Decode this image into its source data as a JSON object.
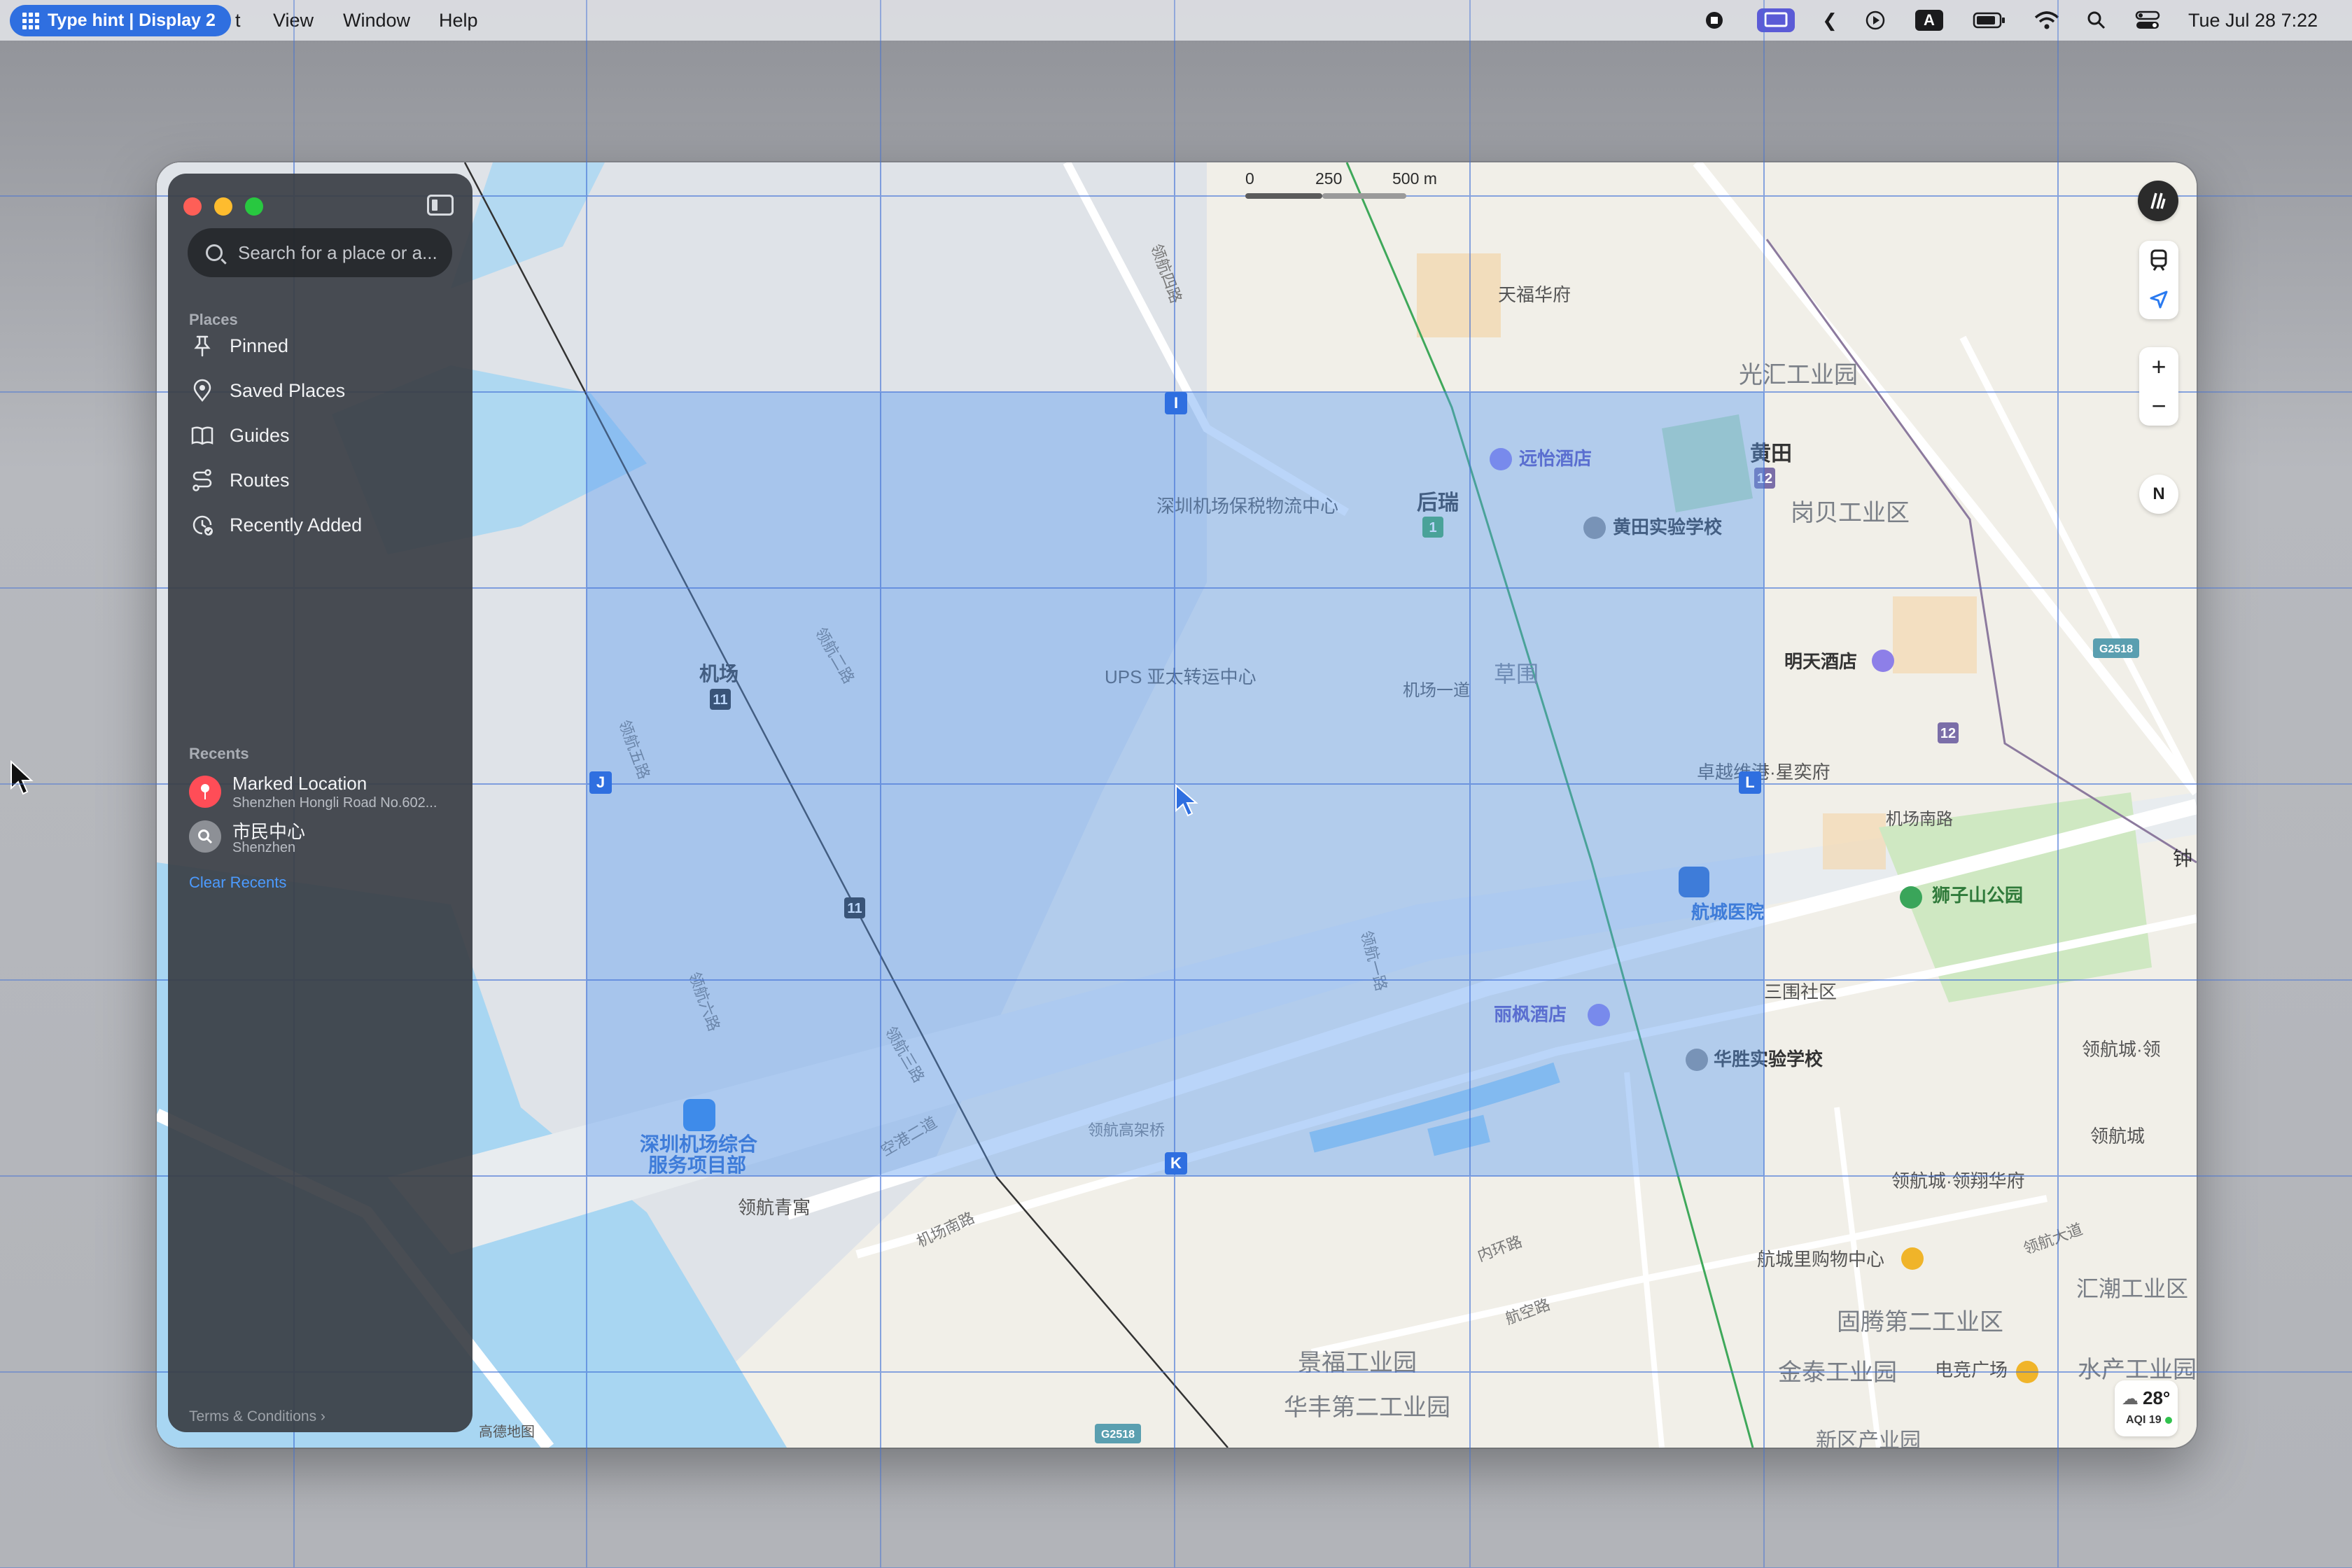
{
  "menubar": {
    "hint_label": "Type hint  |  Display 2",
    "app_menu_tail": "t",
    "items": [
      "View",
      "Window",
      "Help"
    ],
    "clock": "Tue Jul 28  7:22"
  },
  "sidebar": {
    "search_placeholder": "Search for a place or a...",
    "places_header": "Places",
    "places": [
      {
        "label": "Pinned",
        "icon": "pin-icon"
      },
      {
        "label": "Saved Places",
        "icon": "saved-places-icon"
      },
      {
        "label": "Guides",
        "icon": "guides-icon"
      },
      {
        "label": "Routes",
        "icon": "routes-icon"
      },
      {
        "label": "Recently Added",
        "icon": "recently-added-icon"
      }
    ],
    "recents_header": "Recents",
    "recents": [
      {
        "title": "Marked Location",
        "subtitle": "Shenzhen Hongli Road No.602...",
        "icon": "marked-location-icon"
      },
      {
        "title": "市民中心",
        "subtitle": "Shenzhen",
        "icon": "search-icon"
      }
    ],
    "clear_recents": "Clear Recents",
    "terms": "Terms & Conditions"
  },
  "map": {
    "scale": {
      "zero": "0",
      "mid": "250",
      "end": "500 m"
    },
    "compass": "N",
    "zoom_in": "+",
    "zoom_out": "−",
    "attribution": "高德地图",
    "weather": {
      "temp": "28°",
      "aqi": "AQI 19"
    },
    "labels": [
      {
        "text": "天福华府"
      },
      {
        "text": "光汇工业园"
      },
      {
        "text": "远怡酒店"
      },
      {
        "text": "黄田"
      },
      {
        "text": "后瑞"
      },
      {
        "text": "深圳机场保税物流中心"
      },
      {
        "text": "黄田实验学校"
      },
      {
        "text": "岗贝工业区"
      },
      {
        "text": "机场"
      },
      {
        "text": "UPS 亚太转运中心"
      },
      {
        "text": "机场一道"
      },
      {
        "text": "草围"
      },
      {
        "text": "明天酒店"
      },
      {
        "text": "卓越维港·星奕府"
      },
      {
        "text": "机场南路"
      },
      {
        "text": "航城医院"
      },
      {
        "text": "狮子山公园"
      },
      {
        "text": "三围社区"
      },
      {
        "text": "丽枫酒店"
      },
      {
        "text": "华胜实验学校"
      },
      {
        "text": "领航城·领"
      },
      {
        "text": "领航城"
      },
      {
        "text": "深圳机场综合"
      },
      {
        "text": "服务项目部"
      },
      {
        "text": "领航青寓"
      },
      {
        "text": "领航城·领翔华府"
      },
      {
        "text": "航城里购物中心"
      },
      {
        "text": "汇潮工业区"
      },
      {
        "text": "固腾第二工业区"
      },
      {
        "text": "景福工业园"
      },
      {
        "text": "华丰第二工业园"
      },
      {
        "text": "金泰工业园"
      },
      {
        "text": "电竞广场"
      },
      {
        "text": "水产工业园"
      },
      {
        "text": "钟"
      },
      {
        "text": "领航高架桥"
      },
      {
        "text": "领航三路"
      },
      {
        "text": "领航二路"
      },
      {
        "text": "空港二道"
      },
      {
        "text": "内环路"
      },
      {
        "text": "航空路"
      },
      {
        "text": "领航大道"
      },
      {
        "text": "机场南路"
      },
      {
        "text": "新区产业园"
      },
      {
        "text": "领航四路"
      },
      {
        "text": "领航五路"
      },
      {
        "text": "领航一路"
      },
      {
        "text": "领航六路"
      }
    ],
    "station_badges": [
      "11",
      "11",
      "12",
      "12",
      "1"
    ],
    "road_shields": [
      "G2518",
      "G2518"
    ]
  },
  "hints": [
    "I",
    "J",
    "K",
    "L"
  ]
}
